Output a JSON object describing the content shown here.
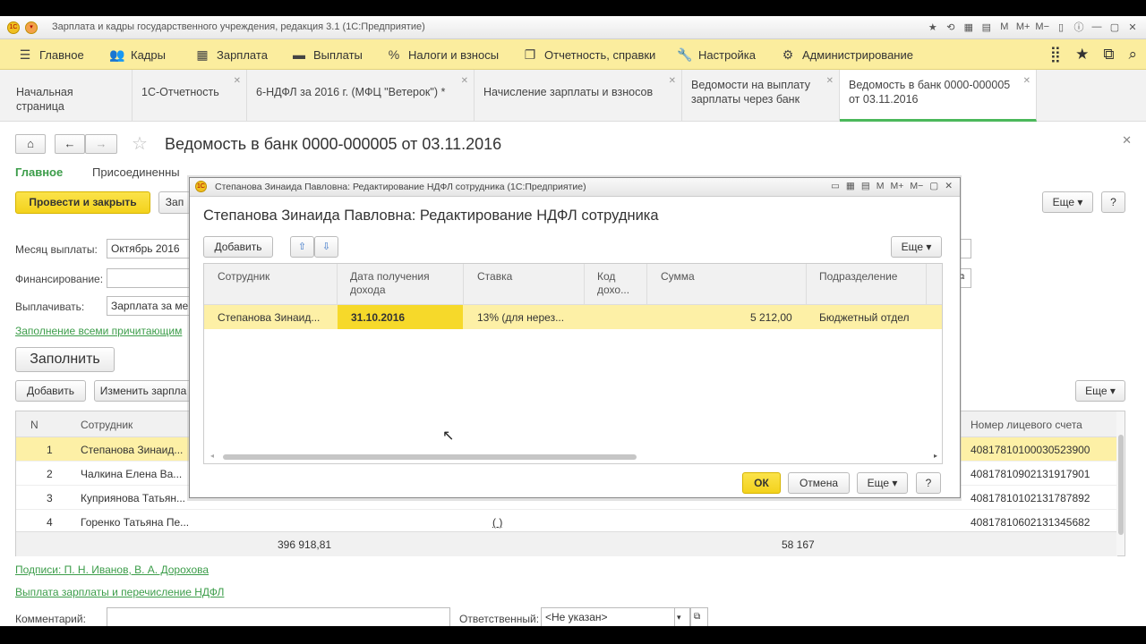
{
  "app": {
    "window_title": "Зарплата и кадры государственного учреждения, редакция 3.1  (1С:Предприятие)",
    "toolbar_icons": [
      "star-icon",
      "history-icon",
      "calc-icon",
      "calendar-icon",
      "M",
      "M+",
      "M−",
      "panel-icon",
      "info-icon",
      "minimize-icon",
      "maximize-icon",
      "close-icon"
    ]
  },
  "menu": {
    "items": [
      {
        "label": "Главное",
        "icon": "menu-icon"
      },
      {
        "label": "Кадры",
        "icon": "people-icon"
      },
      {
        "label": "Зарплата",
        "icon": "calc-icon"
      },
      {
        "label": "Выплаты",
        "icon": "cash-icon"
      },
      {
        "label": "Налоги и взносы",
        "icon": "percent-icon"
      },
      {
        "label": "Отчетность, справки",
        "icon": "report-icon"
      },
      {
        "label": "Настройка",
        "icon": "wrench-icon"
      },
      {
        "label": "Администрирование",
        "icon": "gear-icon"
      }
    ],
    "right_icons": [
      "grid-icon",
      "star-icon",
      "copy-icon",
      "search-icon"
    ]
  },
  "tabs": [
    {
      "label": "Начальная страница"
    },
    {
      "label": "1С-Отчетность"
    },
    {
      "label": "6-НДФЛ за 2016 г. (МФЦ \"Ветерок\") *"
    },
    {
      "label": "Начисление зарплаты и взносов"
    },
    {
      "label_1": "Ведомости на выплату",
      "label_2": "зарплаты через банк"
    },
    {
      "label_1": "Ведомость в банк 0000-000005",
      "label_2": "от 03.11.2016"
    }
  ],
  "document": {
    "title": "Ведомость в банк 0000-000005 от 03.11.2016",
    "nav_main": "Главное",
    "nav_attached": "Присоединенны",
    "post_close_button": "Провести и закрыть",
    "write_button": "Зап",
    "more_button": "Еще",
    "help_button": "?",
    "month_label": "Месяц выплаты:",
    "month_value": "Октябрь 2016",
    "financing_label": "Финансирование:",
    "financing_value": "",
    "pay_label": "Выплачивать:",
    "pay_value": "Зарплата за ме",
    "fill_link": "Заполнение всеми причитающим",
    "fill_button": "Заполнить",
    "add_button": "Добавить",
    "change_button": "Изменить зарпла",
    "table_more_button": "Еще",
    "table": {
      "headers": {
        "n": "N",
        "employee": "Сотрудник",
        "account": "Номер лицевого счета"
      },
      "rows": [
        {
          "n": "1",
          "employee": "Степанова Зинаид...",
          "account": "40817810100030523900"
        },
        {
          "n": "2",
          "employee": "Чалкина Елена Ва...",
          "account": "40817810902131917901"
        },
        {
          "n": "3",
          "employee": "Куприянова Татьян...",
          "account": "40817810102131787892"
        },
        {
          "n": "4",
          "employee": "Горенко Татьяна Пе...",
          "account": "40817810602131345682"
        }
      ],
      "footer_total": "396 918,81",
      "footer_ndfl": "58 167",
      "paren_cell": "(    )"
    },
    "signatures_link": "Подписи: П. Н. Иванов, В. А. Дорохова",
    "payout_link": "Выплата зарплаты и перечисление НДФЛ",
    "comment_label": "Комментарий:",
    "comment_value": "",
    "responsible_label": "Ответственный:",
    "responsible_value": "<Не указан>"
  },
  "dialog": {
    "window_title": "Степанова Зинаида Павловна: Редактирование НДФЛ сотрудника  (1С:Предприятие)",
    "title": "Степанова Зинаида Павловна: Редактирование НДФЛ сотрудника",
    "add_button": "Добавить",
    "more_button": "Еще",
    "headers": {
      "employee": "Сотрудник",
      "date_1": "Дата получения",
      "date_2": "дохода",
      "rate": "Ставка",
      "code_1": "Код",
      "code_2": "дохо...",
      "sum": "Сумма",
      "department": "Подразделение"
    },
    "row": {
      "employee": "Степанова Зинаид...",
      "date": "31.10.2016",
      "rate": "13% (для нерез...",
      "code": "",
      "sum": "5 212,00",
      "department": "Бюджетный отдел"
    },
    "ok_button": "ОК",
    "cancel_button": "Отмена",
    "footer_more_button": "Еще",
    "help_button": "?"
  }
}
